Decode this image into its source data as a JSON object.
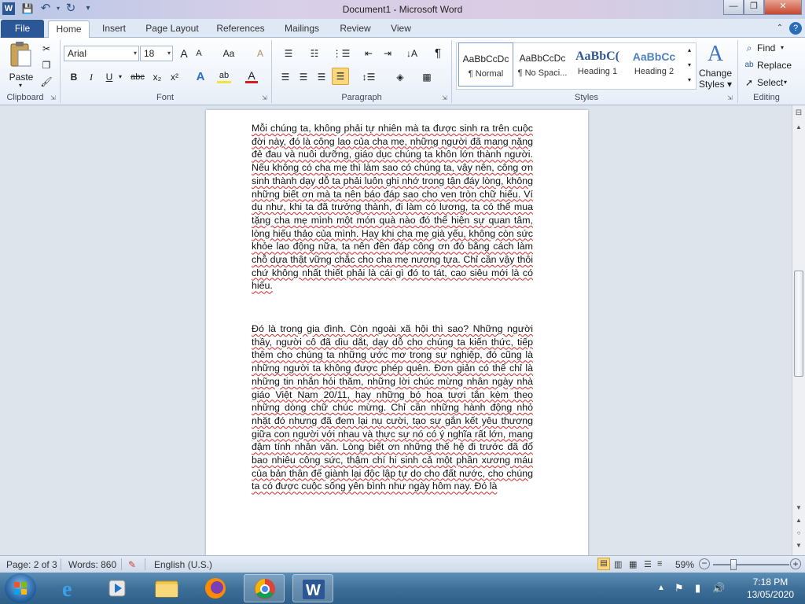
{
  "window": {
    "title": "Document1  -  Microsoft Word"
  },
  "qat": {
    "word_icon": "W",
    "save_icon": "💾",
    "undo_icon": "↶",
    "redo_icon": "↻",
    "customize_icon": "▾"
  },
  "tabs": [
    "File",
    "Home",
    "Insert",
    "Page Layout",
    "References",
    "Mailings",
    "Review",
    "View"
  ],
  "ribbon": {
    "clipboard": {
      "paste_label": "Paste",
      "group_label": "Clipboard"
    },
    "font": {
      "font_name": "Arial",
      "font_size": "18",
      "grow": "A",
      "shrink": "A",
      "case": "Aa",
      "clear": "A",
      "bold": "B",
      "italic": "I",
      "underline": "U",
      "strike": "abc",
      "sub": "x₂",
      "sup": "x²",
      "effects": "A",
      "highlight": "ab",
      "color": "A",
      "group_label": "Font"
    },
    "paragraph": {
      "group_label": "Paragraph",
      "pilcrow": "¶"
    },
    "styles": {
      "group_label": "Styles",
      "items": [
        {
          "sample": "AaBbCcDc",
          "name": "¶ Normal"
        },
        {
          "sample": "AaBbCcDc",
          "name": "¶ No Spaci..."
        },
        {
          "sample": "AaBbC(",
          "name": "Heading 1"
        },
        {
          "sample": "AaBbCc",
          "name": "Heading 2"
        }
      ],
      "change_label_1": "Change",
      "change_label_2": "Styles ▾"
    },
    "editing": {
      "find": "Find",
      "replace": "Replace",
      "select": "Select",
      "group_label": "Editing"
    }
  },
  "document": {
    "paragraph1": "Mỗi chúng ta, không phải tự nhiên mà ta được sinh ra trên cuộc đời này, đó là công lao của cha mẹ, những người đã mang nặng đẻ đau và nuôi dưỡng, giáo dục chúng ta khôn lớn thành người. Nếu không có cha mẹ thì làm sao có chúng ta, vậy nên, công ơn sinh thành dạy dỗ ta phải luôn ghi nhớ trong tận đáy lòng, không những biết ơn mà ta nên báo đáp sao cho ven tròn chữ hiếu. Ví dụ như, khi ta đã trưởng thành, đi làm có lương, ta có thể mua tặng cha mẹ mình một món quà nào đó thể hiện sự quan tâm, lòng hiếu thảo của mình. Hay khi cha mẹ già yếu, không còn sức khỏe lao động nữa, ta nên đền đáp công ơn đó bằng cách làm chỗ dựa thật vững chắc cho cha mẹ nương tựa. Chỉ cần vậy thôi chứ không nhất thiết phải là cái gì đó to tát, cao siêu mới là có hiếu.",
    "paragraph2": "Đó là trong gia đình. Còn ngoài xã hội thì sao? Những người thầy, người cô đã dìu dắt, dạy dỗ cho chúng ta kiến thức, tiếp thêm cho chúng ta những ước mơ trong sự nghiệp, đó cũng là những người ta không được phép quên. Đơn giản có thể chỉ là những tin nhắn hỏi thăm, những lời chúc mừng nhân ngày nhà giáo Việt Nam 20/11, hay những bó hoa tươi tắn kèm theo những dòng chữ chúc mừng. Chỉ cần những hành động nhỏ nhặt đó nhưng đã đem lại nụ cười, tạo sự gắn kết yêu thương giữa con người với nhau và thực sự nó có ý nghĩa rất lớn, mang đậm tính nhân văn. Lòng biết ơn những thế hệ đi trước đã đổ bao nhiêu công sức, thậm chí hi sinh cả một phần xương máu của bản thân để giành lại độc lập tự do cho đất nước, cho chúng ta có được cuộc sống yên bình như ngày hôm nay. Đó là"
  },
  "status": {
    "page": "Page: 2 of 3",
    "words": "Words: 860",
    "language": "English (U.S.)",
    "zoom": "59%"
  },
  "zoom_level": 59,
  "taskbar": {
    "time": "7:18 PM",
    "date": "13/05/2020"
  },
  "colors": {
    "file_tab": "#2b5797",
    "taskbar": "#3d6f98",
    "spell_underline": "#d42a2a"
  }
}
